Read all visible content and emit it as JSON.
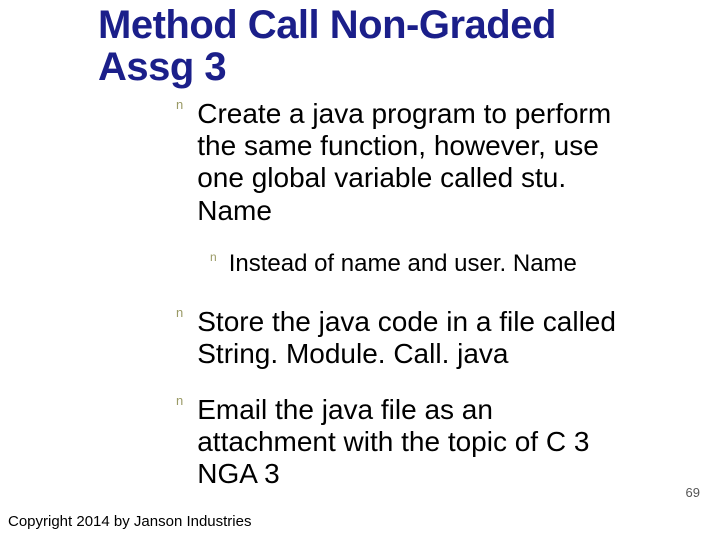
{
  "title": "Method Call Non-Graded Assg 3",
  "bullets": {
    "b1": "Create a java program to perform the same function, however, use one global variable called stu. Name",
    "b1_sub": "Instead of name and user. Name",
    "b2": "Store the java code in a file called String. Module. Call. java",
    "b3": "Email the java file as an attachment with the topic of C 3 NGA 3"
  },
  "marker": "n",
  "page_number": "69",
  "copyright": "Copyright 2014 by Janson Industries"
}
